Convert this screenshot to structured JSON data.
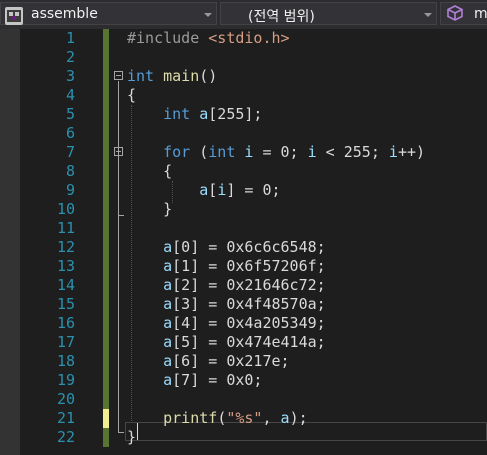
{
  "navbar": {
    "project_name": "assemble",
    "scope_label": "(전역 범위)",
    "member_label": "m",
    "project_icon": "project-icon",
    "scope_icon": "cube-icon"
  },
  "editor": {
    "lines": [
      {
        "num": "1",
        "tokens": [
          {
            "t": "#include ",
            "c": "pp"
          },
          {
            "t": "<stdio.h>",
            "c": "str"
          }
        ]
      },
      {
        "num": "2",
        "tokens": []
      },
      {
        "num": "3",
        "tokens": [
          {
            "t": "int",
            "c": "kw"
          },
          {
            "t": " ",
            "c": "plain"
          },
          {
            "t": "main",
            "c": "fn"
          },
          {
            "t": "()",
            "c": "plain"
          }
        ]
      },
      {
        "num": "4",
        "tokens": [
          {
            "t": "{",
            "c": "plain"
          }
        ]
      },
      {
        "num": "5",
        "tokens": [
          {
            "t": "    ",
            "c": "plain"
          },
          {
            "t": "int",
            "c": "kw"
          },
          {
            "t": " ",
            "c": "plain"
          },
          {
            "t": "a",
            "c": "var"
          },
          {
            "t": "[255];",
            "c": "plain"
          }
        ]
      },
      {
        "num": "6",
        "tokens": []
      },
      {
        "num": "7",
        "tokens": [
          {
            "t": "    ",
            "c": "plain"
          },
          {
            "t": "for",
            "c": "kw"
          },
          {
            "t": " (",
            "c": "plain"
          },
          {
            "t": "int",
            "c": "kw"
          },
          {
            "t": " ",
            "c": "plain"
          },
          {
            "t": "i",
            "c": "var"
          },
          {
            "t": " = 0; ",
            "c": "plain"
          },
          {
            "t": "i",
            "c": "var"
          },
          {
            "t": " < 255; ",
            "c": "plain"
          },
          {
            "t": "i",
            "c": "var"
          },
          {
            "t": "++)",
            "c": "plain"
          }
        ]
      },
      {
        "num": "8",
        "tokens": [
          {
            "t": "    {",
            "c": "plain"
          }
        ]
      },
      {
        "num": "9",
        "tokens": [
          {
            "t": "        ",
            "c": "plain"
          },
          {
            "t": "a",
            "c": "var"
          },
          {
            "t": "[",
            "c": "plain"
          },
          {
            "t": "i",
            "c": "var"
          },
          {
            "t": "] = 0;",
            "c": "plain"
          }
        ]
      },
      {
        "num": "10",
        "tokens": [
          {
            "t": "    }",
            "c": "plain"
          }
        ]
      },
      {
        "num": "11",
        "tokens": []
      },
      {
        "num": "12",
        "tokens": [
          {
            "t": "    ",
            "c": "plain"
          },
          {
            "t": "a",
            "c": "var"
          },
          {
            "t": "[0] = 0x6c6c6548;",
            "c": "plain"
          }
        ]
      },
      {
        "num": "13",
        "tokens": [
          {
            "t": "    ",
            "c": "plain"
          },
          {
            "t": "a",
            "c": "var"
          },
          {
            "t": "[1] = 0x6f57206f;",
            "c": "plain"
          }
        ]
      },
      {
        "num": "14",
        "tokens": [
          {
            "t": "    ",
            "c": "plain"
          },
          {
            "t": "a",
            "c": "var"
          },
          {
            "t": "[2] = 0x21646c72;",
            "c": "plain"
          }
        ]
      },
      {
        "num": "15",
        "tokens": [
          {
            "t": "    ",
            "c": "plain"
          },
          {
            "t": "a",
            "c": "var"
          },
          {
            "t": "[3] = 0x4f48570a;",
            "c": "plain"
          }
        ]
      },
      {
        "num": "16",
        "tokens": [
          {
            "t": "    ",
            "c": "plain"
          },
          {
            "t": "a",
            "c": "var"
          },
          {
            "t": "[4] = 0x4a205349;",
            "c": "plain"
          }
        ]
      },
      {
        "num": "17",
        "tokens": [
          {
            "t": "    ",
            "c": "plain"
          },
          {
            "t": "a",
            "c": "var"
          },
          {
            "t": "[5] = 0x474e414a;",
            "c": "plain"
          }
        ]
      },
      {
        "num": "18",
        "tokens": [
          {
            "t": "    ",
            "c": "plain"
          },
          {
            "t": "a",
            "c": "var"
          },
          {
            "t": "[6] = 0x217e;",
            "c": "plain"
          }
        ]
      },
      {
        "num": "19",
        "tokens": [
          {
            "t": "    ",
            "c": "plain"
          },
          {
            "t": "a",
            "c": "var"
          },
          {
            "t": "[7] = 0x0;",
            "c": "plain"
          }
        ]
      },
      {
        "num": "20",
        "tokens": []
      },
      {
        "num": "21",
        "tokens": [
          {
            "t": "    ",
            "c": "plain"
          },
          {
            "t": "printf",
            "c": "fn"
          },
          {
            "t": "(",
            "c": "plain"
          },
          {
            "t": "\"%s\"",
            "c": "str"
          },
          {
            "t": ", ",
            "c": "plain"
          },
          {
            "t": "a",
            "c": "var"
          },
          {
            "t": ");",
            "c": "plain"
          }
        ]
      },
      {
        "num": "22",
        "tokens": [
          {
            "t": "}",
            "c": "plain"
          }
        ]
      }
    ],
    "colors": {
      "background": "#1e1e1e",
      "line_number": "#2b91af",
      "keyword": "#569cd6",
      "preprocessor": "#9b9b9b",
      "string": "#d69d85",
      "function": "#dcdcaa",
      "variable": "#9cdcfe",
      "saved_change_bar": "#577430",
      "unsaved_change_bar": "#efef91"
    },
    "unsaved_lines": [
      "21"
    ]
  }
}
